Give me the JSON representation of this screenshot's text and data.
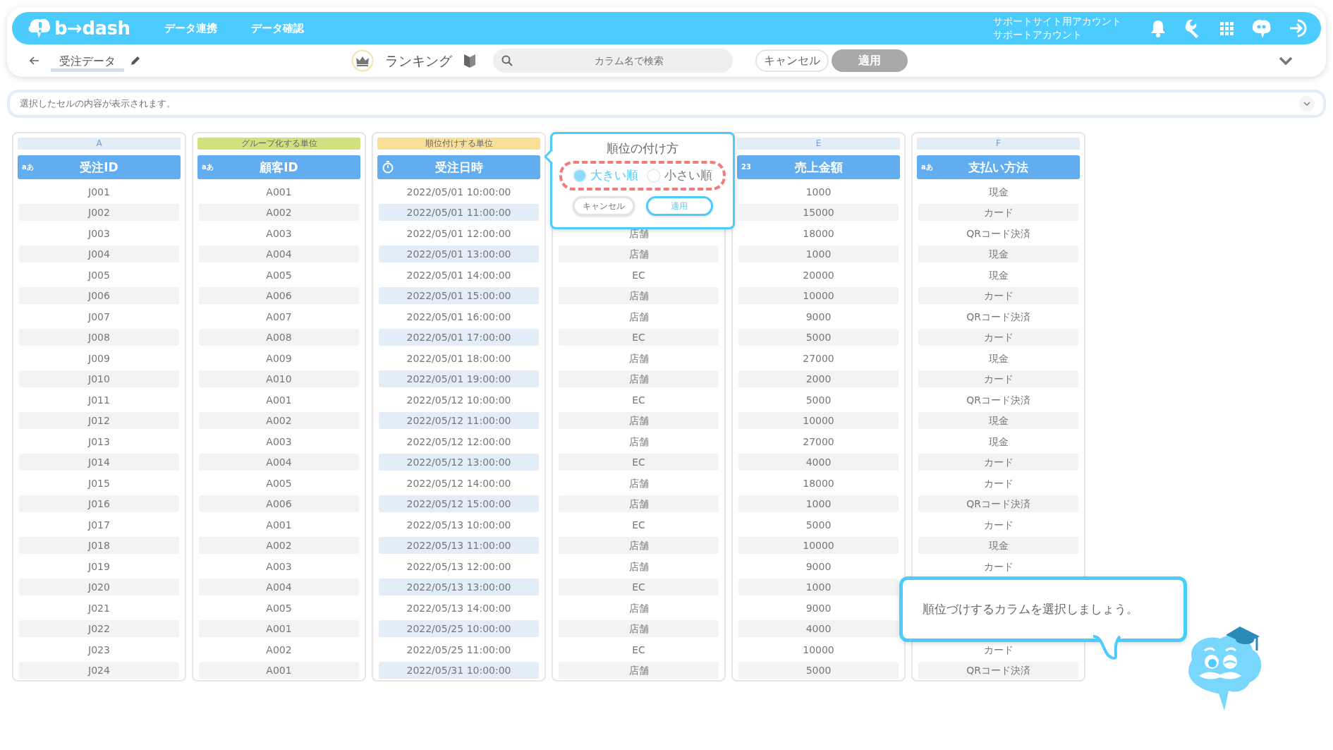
{
  "navbar": {
    "logo": "b→dash",
    "links": [
      "データ連携",
      "データ確認"
    ],
    "account": {
      "site": "サポートサイト用アカウント",
      "user": "サポートアカウント"
    }
  },
  "toolbar": {
    "title": "受注データ",
    "mode": "ランキング",
    "search": {
      "placeholder": "カラム名で検索"
    },
    "buttons": [
      {
        "label": "キャンセル",
        "disabled": false
      },
      {
        "label": "適用",
        "disabled": true
      }
    ]
  },
  "cell_viewer": {
    "placeholder": "選択したセルの内容が表示されます。"
  },
  "columns": [
    {
      "tag": {
        "text": "A",
        "kind": "letter"
      },
      "type": {
        "kind": "text",
        "label": "aあ"
      },
      "name": "受注ID",
      "highlighted": false,
      "cells": [
        "J001",
        "J002",
        "J003",
        "J004",
        "J005",
        "J006",
        "J007",
        "J008",
        "J009",
        "J010",
        "J011",
        "J012",
        "J013",
        "J014",
        "J015",
        "J016",
        "J017",
        "J018",
        "J019",
        "J020",
        "J021",
        "J022",
        "J023",
        "J024"
      ]
    },
    {
      "tag": {
        "text": "グループ化する単位",
        "kind": "group"
      },
      "type": {
        "kind": "text",
        "label": "aあ"
      },
      "name": "顧客ID",
      "highlighted": false,
      "cells": [
        "A001",
        "A002",
        "A003",
        "A004",
        "A005",
        "A006",
        "A007",
        "A008",
        "A009",
        "A010",
        "A001",
        "A002",
        "A003",
        "A004",
        "A005",
        "A006",
        "A001",
        "A002",
        "A003",
        "A004",
        "A005",
        "A001",
        "A002",
        "A001"
      ]
    },
    {
      "tag": {
        "text": "順位付けする単位",
        "kind": "rank"
      },
      "type": {
        "kind": "datetime"
      },
      "name": "受注日時",
      "highlighted": true,
      "cells": [
        "2022/05/01 10:00:00",
        "2022/05/01 11:00:00",
        "2022/05/01 12:00:00",
        "2022/05/01 13:00:00",
        "2022/05/01 14:00:00",
        "2022/05/01 15:00:00",
        "2022/05/01 16:00:00",
        "2022/05/01 17:00:00",
        "2022/05/01 18:00:00",
        "2022/05/01 19:00:00",
        "2022/05/12 10:00:00",
        "2022/05/12 11:00:00",
        "2022/05/12 12:00:00",
        "2022/05/12 13:00:00",
        "2022/05/12 14:00:00",
        "2022/05/12 15:00:00",
        "2022/05/13 10:00:00",
        "2022/05/13 11:00:00",
        "2022/05/13 12:00:00",
        "2022/05/13 13:00:00",
        "2022/05/13 14:00:00",
        "2022/05/25 10:00:00",
        "2022/05/25 11:00:00",
        "2022/05/31 10:00:00"
      ]
    },
    {
      "highlighted": false,
      "cells": [
        null,
        null,
        "店舗",
        "店舗",
        "EC",
        "店舗",
        "店舗",
        "EC",
        "店舗",
        "店舗",
        "EC",
        "店舗",
        "店舗",
        "EC",
        "店舗",
        "店舗",
        "EC",
        "店舗",
        "店舗",
        "EC",
        "店舗",
        "店舗",
        "EC",
        "店舗"
      ]
    },
    {
      "tag": {
        "text": "E",
        "kind": "letter"
      },
      "type": {
        "kind": "number",
        "label": "23"
      },
      "name": "売上金額",
      "highlighted": false,
      "cells": [
        "1000",
        "15000",
        "18000",
        "1000",
        "20000",
        "10000",
        "9000",
        "5000",
        "27000",
        "2000",
        "5000",
        "10000",
        "27000",
        "4000",
        "18000",
        "1000",
        "5000",
        "10000",
        "9000",
        "1000",
        "9000",
        "4000",
        "10000",
        "5000"
      ]
    },
    {
      "tag": {
        "text": "F",
        "kind": "letter"
      },
      "type": {
        "kind": "text",
        "label": "aあ"
      },
      "name": "支払い方法",
      "highlighted": false,
      "cells": [
        "現金",
        "カード",
        "QRコード決済",
        "現金",
        "現金",
        "カード",
        "QRコード決済",
        "カード",
        "現金",
        "カード",
        "QRコード決済",
        "現金",
        "現金",
        "カード",
        "カード",
        "QRコード決済",
        "カード",
        "現金",
        "カード",
        null,
        null,
        null,
        "カード",
        "QRコード決済"
      ]
    }
  ],
  "ranking_popup": {
    "title": "順位の付け方",
    "options": [
      {
        "label": "大きい順",
        "selected": true
      },
      {
        "label": "小さい順",
        "selected": false
      }
    ],
    "buttons": [
      {
        "label": "キャンセル",
        "kind": "secondary"
      },
      {
        "label": "適用",
        "kind": "primary"
      }
    ]
  },
  "hint": {
    "text": "順位づけするカラムを選択しましょう。"
  }
}
